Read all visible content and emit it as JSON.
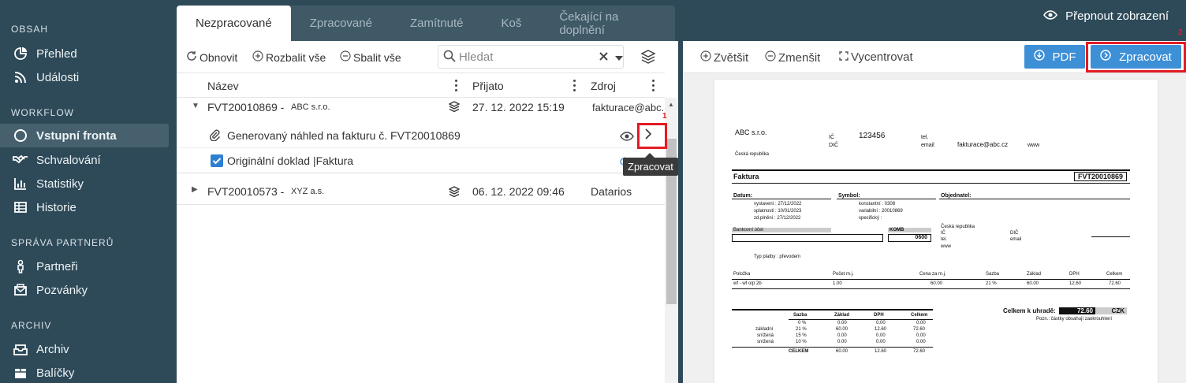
{
  "sidebar": {
    "sections": [
      {
        "title": "OBSAH",
        "items": [
          {
            "label": "Přehled",
            "icon": "pie-chart-icon"
          },
          {
            "label": "Události",
            "icon": "rss-icon"
          }
        ]
      },
      {
        "title": "WORKFLOW",
        "items": [
          {
            "label": "Vstupní fronta",
            "icon": "circle-icon",
            "active": true
          },
          {
            "label": "Schvalování",
            "icon": "handshake-icon"
          },
          {
            "label": "Statistiky",
            "icon": "bar-chart-icon"
          },
          {
            "label": "Historie",
            "icon": "table-icon"
          }
        ]
      },
      {
        "title": "SPRÁVA PARTNERŮ",
        "items": [
          {
            "label": "Partneři",
            "icon": "person-icon"
          },
          {
            "label": "Pozvánky",
            "icon": "envelope-icon"
          }
        ]
      },
      {
        "title": "ARCHIV",
        "items": [
          {
            "label": "Archiv",
            "icon": "archive-icon"
          },
          {
            "label": "Balíčky",
            "icon": "package-icon"
          }
        ]
      }
    ]
  },
  "top": {
    "toggle_view": "Přepnout zobrazení"
  },
  "tabs": [
    "Nezpracované",
    "Zpracované",
    "Zamítnuté",
    "Koš",
    "Čekající na doplnění"
  ],
  "toolbar": {
    "refresh": "Obnovit",
    "expand": "Rozbalit vše",
    "collapse": "Sbalit vše",
    "search_placeholder": "Hledat"
  },
  "columns": {
    "name": "Název",
    "received": "Přijato",
    "source": "Zdroj"
  },
  "rows": [
    {
      "id": "FVT20010869 -",
      "company": "ABC s.r.o.",
      "date": "27. 12. 2022 15:19",
      "source": "fakturace@abc.cz",
      "children": [
        {
          "label": "Generovaný náhled na fakturu č. FVT20010869"
        },
        {
          "label": "Originální doklad |Faktura"
        }
      ]
    },
    {
      "id": "FVT20010573 -",
      "company": "XYZ a.s.",
      "date": "06. 12. 2022 09:46",
      "source": "Datarios"
    }
  ],
  "tooltip": "Zpracovat",
  "markers": {
    "one": "1",
    "two": "2"
  },
  "viewer": {
    "zoom_in": "Zvětšit",
    "zoom_out": "Zmenšit",
    "center": "Vycentrovat",
    "pdf": "PDF",
    "process": "Zpracovat"
  },
  "invoice": {
    "supplier": "ABC s.r.o.",
    "country": "Česká republika",
    "ic_label": "IČ",
    "ic": "123456",
    "dic_label": "DIČ",
    "tel_label": "tel.",
    "email_label": "email",
    "email": "fakturace@abc.cz",
    "www_label": "www",
    "title": "Faktura",
    "number": "FVT20010869",
    "datum_label": "Datum:",
    "symbol_label": "Symbol:",
    "objednatel_label": "Objednatel:",
    "dates": [
      "vystavení : 27/12/2022",
      "splatnosti : 10/01/2023",
      "zd.plnění : 27/12/2022"
    ],
    "symbols": [
      "konstantní : 0308",
      "variabilní : 20010869",
      "specifický :"
    ],
    "buyer_country": "Česká republika",
    "bank_label": "Bankovní účet",
    "komb_label": "KOMB",
    "komb": "0600",
    "platba": "Typ platby : převodem",
    "items_head": [
      "Položka",
      "Počet m.j.",
      "Cena za m.j.",
      "Sazba",
      "Základ",
      "DPH",
      "Celkem"
    ],
    "items": [
      [
        "wf - wf o/p 2b",
        "1.00",
        "60.00",
        "21 %",
        "60.00",
        "12.60",
        "72.60"
      ]
    ],
    "vat_head": [
      "Sazba",
      "Základ",
      "DPH",
      "Celkem"
    ],
    "vat_rows": [
      [
        "",
        "0 %",
        "0.00",
        "0.00",
        "0.00"
      ],
      [
        "základní",
        "21 %",
        "60.00",
        "12.60",
        "72.60"
      ],
      [
        "snížená",
        "15 %",
        "0.00",
        "0.00",
        "0.00"
      ],
      [
        "snížená",
        "10 %",
        "0.00",
        "0.00",
        "0.00"
      ]
    ],
    "vat_total": [
      "CELKEM",
      "60.00",
      "12.60",
      "72.60"
    ],
    "to_pay_label": "Celkem k uhradě:",
    "to_pay": "72.60",
    "currency": "CZK",
    "note": "Pozn.: částky obsahují zaokrouhlení"
  }
}
